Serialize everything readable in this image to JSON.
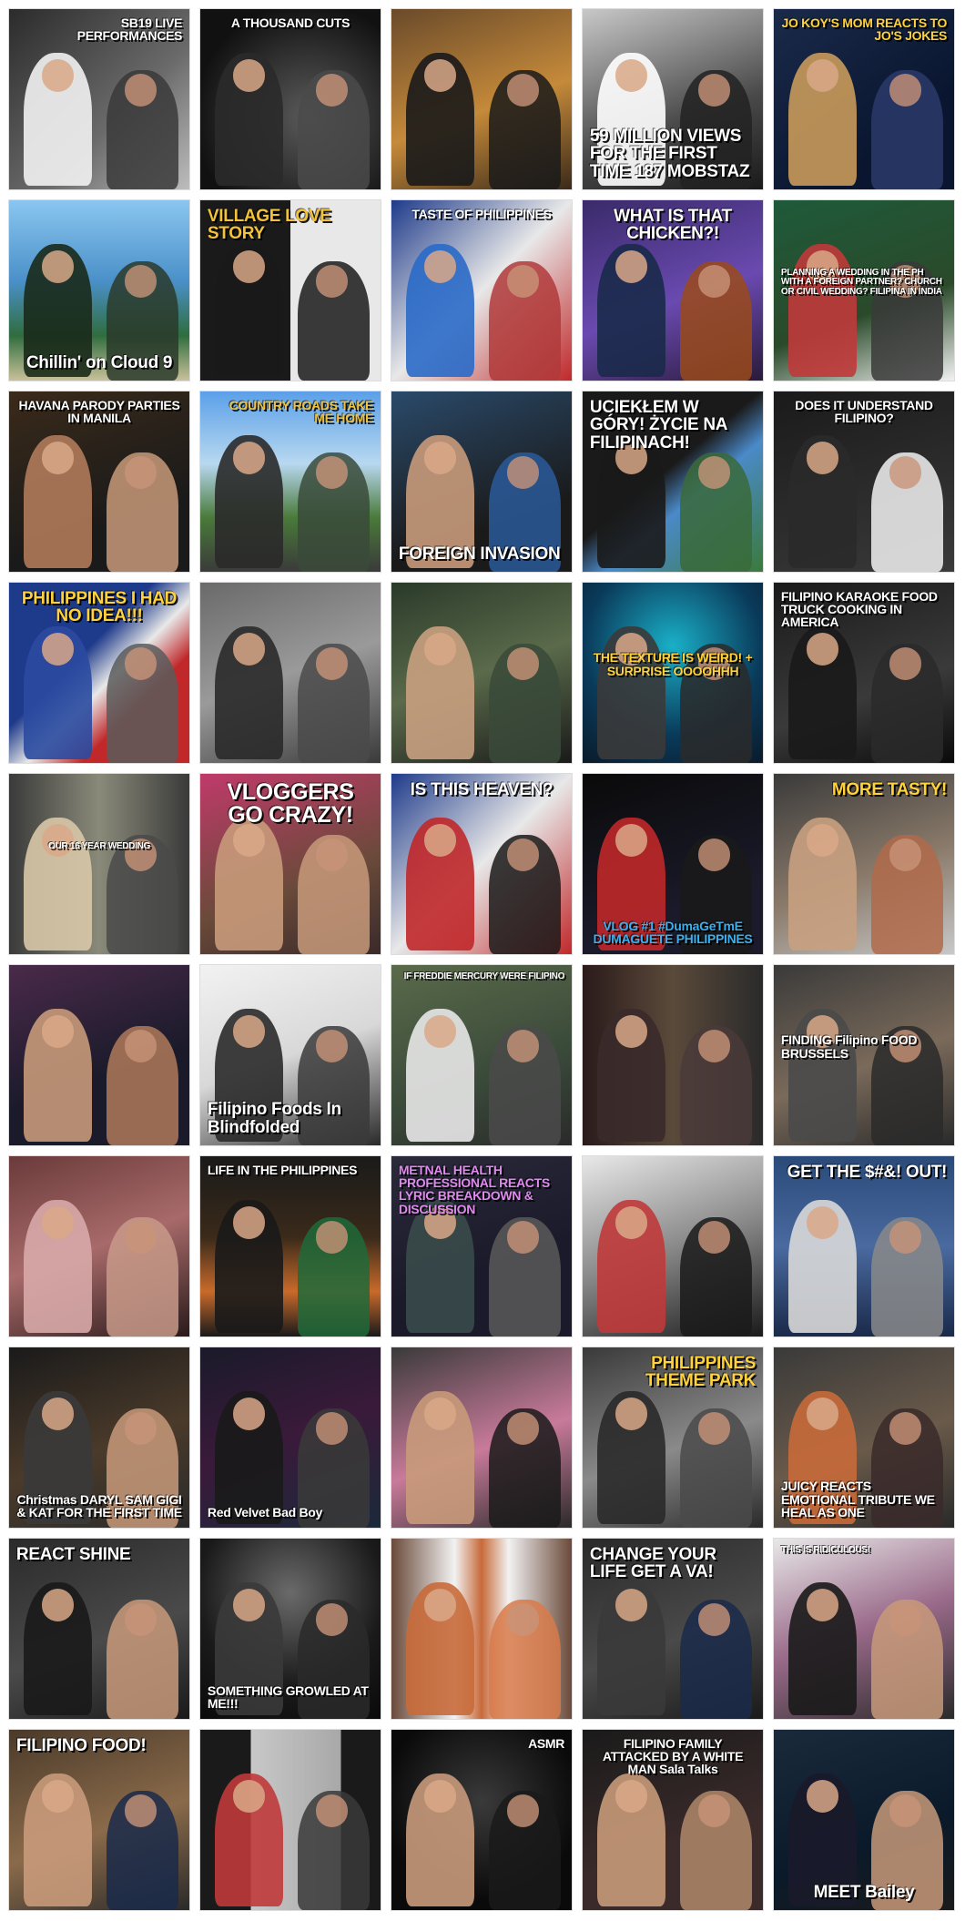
{
  "tiles": [
    {
      "caption": "SB19 LIVE PERFORMANCES",
      "bg": "linear-gradient(135deg,#2b2b2b,#6a6a6a 60%,#bdbdbd)",
      "fg": "#ffffff",
      "pos": "top",
      "align": "right",
      "size": "s",
      "fig": [
        "#f2f2f2",
        "#3a3a3a"
      ]
    },
    {
      "caption": "A THOUSAND CUTS",
      "bg": "radial-gradient(circle at 60% 60%,#5a5a5a,#111111 75%)",
      "fg": "#ffffff",
      "pos": "top",
      "align": "center",
      "size": "s",
      "fig": [
        "#2a2a2a",
        "#4a4a4a"
      ]
    },
    {
      "caption": "",
      "bg": "linear-gradient(160deg,#6a4a2a,#c58a3a 55%,#3a2a1a)",
      "fg": "#ffffff",
      "pos": "bot",
      "align": "center",
      "size": "s",
      "fig": [
        "#1a1a1a",
        "#1a1a1a"
      ]
    },
    {
      "caption": "59 MILLION VIEWS FOR THE FIRST TIME 187 MOBSTAZ",
      "bg": "linear-gradient(160deg,#c8c8c8,#4a4a4a 60%,#1a1a1a)",
      "fg": "#ffffff",
      "pos": "bot",
      "align": "left",
      "size": "m",
      "fig": [
        "#ffffff",
        "#222222"
      ]
    },
    {
      "caption": "JO KOY'S MOM REACTS TO JO'S JOKES",
      "bg": "linear-gradient(140deg,#1a2a4a,#0a1630 70%)",
      "fg": "#ffd23a",
      "pos": "top",
      "align": "right",
      "size": "s",
      "fig": [
        "#c99a5a",
        "#2a3a6a"
      ]
    },
    {
      "caption": "Chillin' on Cloud 9",
      "bg": "linear-gradient(180deg,#8ac6f0,#4a90c8 45%,#2f6d3e 75%,#c9c19a)",
      "fg": "#ffffff",
      "pos": "bot",
      "align": "center",
      "size": "m",
      "fig": [
        "#1a2a1a",
        "#2a3a2a"
      ]
    },
    {
      "caption": "VILLAGE LOVE STORY",
      "bg": "linear-gradient(90deg,#1a1a1a 50%,#e8e8e8 50%)",
      "fg": "#f2c23a",
      "pos": "top",
      "align": "left",
      "size": "m",
      "fig": [
        "#1a1a1a",
        "#1a1a1a"
      ]
    },
    {
      "caption": "TASTE OF PHILIPPINES",
      "bg": "linear-gradient(135deg,#1e3a8a,#e8e8e8 50%,#c0282a)",
      "fg": "#ffffff",
      "pos": "top",
      "align": "center",
      "size": "s",
      "fig": [
        "#2a6ac8",
        "#b03a3a"
      ]
    },
    {
      "caption": "WHAT IS THAT CHICKEN?!",
      "bg": "linear-gradient(160deg,#3a2a6a,#6a4ab0 55%,#2a1a3a)",
      "fg": "#ffffff",
      "pos": "top",
      "align": "center",
      "size": "m",
      "fig": [
        "#1a2a4a",
        "#9a4a1a"
      ]
    },
    {
      "caption": "PLANNING A WEDDING IN THE PH WITH A FOREIGN PARTNER? CHURCH OR CIVIL WEDDING? FILIPINA IN INDIA",
      "bg": "linear-gradient(160deg,#1e5a3a,#2a4a2a 60%,#f2f2f2)",
      "fg": "#ffffff",
      "pos": "mid",
      "align": "left",
      "size": "xs",
      "fig": [
        "#c03a3a",
        "#3a3a3a"
      ]
    },
    {
      "caption": "HAVANA PARODY PARTIES IN MANILA",
      "bg": "linear-gradient(160deg,#3a2a1a,#1a1a1a 70%)",
      "fg": "#ffffff",
      "pos": "top",
      "align": "center",
      "size": "s",
      "fig": [
        "#b07a5a",
        "#c89a7a"
      ]
    },
    {
      "caption": "COUNTRY ROADS TAKE ME HOME",
      "bg": "linear-gradient(180deg,#5aa0e8,#b8d8f0 40%,#4a7a3a 70%,#3a3a3a)",
      "fg": "#f2c23a",
      "pos": "top",
      "align": "right",
      "size": "s",
      "fig": [
        "#2a2a2a",
        "#3a4a3a"
      ]
    },
    {
      "caption": "FOREIGN INVASION",
      "bg": "linear-gradient(160deg,#2a4a6a,#1a1a1a 70%)",
      "fg": "#ffffff",
      "pos": "bot",
      "align": "left",
      "size": "m",
      "fig": [
        "#c89a7a",
        "#2a5a9a"
      ]
    },
    {
      "caption": "UCIEKŁEM W GÓRY! ŻYCIE NA FILIPINACH!",
      "bg": "linear-gradient(140deg,#1a1a1a 45%,#4a8ac8 60%,#3a7a3a)",
      "fg": "#ffffff",
      "pos": "top",
      "align": "left",
      "size": "m",
      "fig": [
        "#1a1a1a",
        "#3a6a3a"
      ]
    },
    {
      "caption": "DOES IT UNDERSTAND FILIPINO?",
      "bg": "linear-gradient(160deg,#1a1a1a,#3a3a3a)",
      "fg": "#ffffff",
      "pos": "top",
      "align": "center",
      "size": "s",
      "fig": [
        "#2a2a2a",
        "#f2f2f2"
      ]
    },
    {
      "caption": "PHILIPPINES I HAD NO IDEA!!!",
      "bg": "linear-gradient(135deg,#1e3a8a 40%,#e8e8e8 55%,#c0282a 70%)",
      "fg": "#ffd23a",
      "pos": "top",
      "align": "center",
      "size": "m",
      "fig": [
        "#2a4aa0",
        "#5a5a5a"
      ]
    },
    {
      "caption": "",
      "bg": "linear-gradient(160deg,#6a6a6a,#9a9a9a 50%,#3a3a3a)",
      "fg": "#ffffff",
      "pos": "bot",
      "align": "center",
      "size": "s",
      "fig": [
        "#2a2a2a",
        "#4a4a4a"
      ]
    },
    {
      "caption": "",
      "bg": "linear-gradient(160deg,#2a3a2a,#5a6a4a 50%,#1a1a1a)",
      "fg": "#ffffff",
      "pos": "bot",
      "align": "center",
      "size": "s",
      "fig": [
        "#c8a080",
        "#3a4a3a"
      ]
    },
    {
      "caption": "THE TEXTURE IS WEIRD! + SURPRISE OOOOHHH",
      "bg": "radial-gradient(circle at 50% 35%,#1ab0c8,#0a3a5a 60%,#0a1a2a)",
      "fg": "#ffd23a",
      "pos": "mid",
      "align": "center",
      "size": "s",
      "fig": [
        "#3a3a3a",
        "#2a2a2a"
      ]
    },
    {
      "caption": "FILIPINO KARAOKE FOOD TRUCK COOKING IN AMERICA",
      "bg": "linear-gradient(160deg,#1a1a1a,#3a3a3a 60%,#0a0a0a)",
      "fg": "#ffffff",
      "pos": "top",
      "align": "left",
      "size": "s",
      "fig": [
        "#1a1a1a",
        "#2a2a2a"
      ]
    },
    {
      "caption": "OUR 16 YEAR WEDDING",
      "bg": "linear-gradient(90deg,#3a3a3a,#8a8a7a 50%,#3a3a3a)",
      "fg": "#ffffff",
      "pos": "mid",
      "align": "center",
      "size": "xs",
      "fig": [
        "#d8c8a8",
        "#4a4a4a"
      ]
    },
    {
      "caption": "VLOGGERS GO CRAZY!",
      "bg": "linear-gradient(160deg,#c03a6a,#6a4a3a 60%,#3a2a2a)",
      "fg": "#ffffff",
      "pos": "top",
      "align": "center",
      "size": "l",
      "fig": [
        "#c89a7a",
        "#c89a7a"
      ]
    },
    {
      "caption": "IS THIS HEAVEN?",
      "bg": "linear-gradient(135deg,#1e3a8a,#e8e8e8 50%,#c0282a)",
      "fg": "#ffffff",
      "pos": "top",
      "align": "center",
      "size": "m",
      "fig": [
        "#c0282a",
        "#1a1a1a"
      ]
    },
    {
      "caption": "VLOG #1 #DumaGeTmE DUMAGUETE PHILIPPINES",
      "bg": "linear-gradient(160deg,#0a0a0a,#1a1a2a 70%)",
      "fg": "#3ab0f0",
      "pos": "bot",
      "align": "center",
      "size": "s",
      "fig": [
        "#c0282a",
        "#1a1a1a"
      ]
    },
    {
      "caption": "MORE TASTY!",
      "bg": "linear-gradient(160deg,#3a3a3a,#8a7a6a 55%,#c8c8c8)",
      "fg": "#ffd23a",
      "pos": "top",
      "align": "right",
      "size": "m",
      "fig": [
        "#c8a080",
        "#b06a4a"
      ]
    },
    {
      "caption": "",
      "bg": "linear-gradient(160deg,#4a2a4a,#1a1a2a 60%)",
      "fg": "#ffffff",
      "pos": "bot",
      "align": "center",
      "size": "s",
      "fig": [
        "#c89a7a",
        "#b07a5a"
      ]
    },
    {
      "caption": "Filipino Foods In Blindfolded",
      "bg": "linear-gradient(160deg,#f2f2f2,#d8d8d8 50%,#2a2a2a)",
      "fg": "#ffffff",
      "pos": "bot",
      "align": "left",
      "size": "m",
      "fig": [
        "#2a2a2a",
        "#3a3a3a"
      ]
    },
    {
      "caption": "IF FREDDIE MERCURY WERE FILIPINO",
      "bg": "linear-gradient(160deg,#5a6a4a,#3a4a3a 60%,#2a2a2a)",
      "fg": "#ffffff",
      "pos": "top",
      "align": "right",
      "size": "xs",
      "fig": [
        "#e8e8e8",
        "#4a4a4a"
      ]
    },
    {
      "caption": "",
      "bg": "linear-gradient(90deg,#2a1a1a,#5a4a3a 50%,#2a2a2a)",
      "fg": "#ffffff",
      "pos": "bot",
      "align": "center",
      "size": "s",
      "fig": [
        "#3a2a2a",
        "#4a3a3a"
      ]
    },
    {
      "caption": "FINDING Filipino FOOD BRUSSELS",
      "bg": "linear-gradient(160deg,#3a3a3a,#7a6a5a 55%,#2a2a2a)",
      "fg": "#ffffff",
      "pos": "mid",
      "align": "left",
      "size": "s",
      "fig": [
        "#4a4a4a",
        "#2a2a2a"
      ]
    },
    {
      "caption": "",
      "bg": "linear-gradient(160deg,#6a3a3a,#a86a6a 50%,#2a1a1a)",
      "fg": "#ffffff",
      "pos": "bot",
      "align": "center",
      "size": "s",
      "fig": [
        "#d8a8a8",
        "#c89a8a"
      ]
    },
    {
      "caption": "LIFE IN THE PHILIPPINES",
      "bg": "linear-gradient(180deg,#1a1a1a,#3a2a1a 45%,#c86a2a 75%,#1a1a1a)",
      "fg": "#ffffff",
      "pos": "top",
      "align": "left",
      "size": "s",
      "fig": [
        "#1a1a1a",
        "#1e6a3a"
      ]
    },
    {
      "caption": "METNAL HEALTH PROFESSIONAL REACTS LYRIC BREAKDOWN & DISCUSSION",
      "bg": "linear-gradient(160deg,#2a2a3a,#1a1a2a 60%)",
      "fg": "#e08af0",
      "pos": "top",
      "align": "left",
      "size": "s",
      "fig": [
        "#3a4a4a",
        "#5a5a5a"
      ]
    },
    {
      "caption": "",
      "bg": "linear-gradient(160deg,#e8e8e8,#8a8a8a 50%,#1a1a1a)",
      "fg": "#ffffff",
      "pos": "bot",
      "align": "center",
      "size": "s",
      "fig": [
        "#c03a3a",
        "#1a1a1a"
      ]
    },
    {
      "caption": "GET THE $#&! OUT!",
      "bg": "linear-gradient(180deg,#2a4a7a,#4a6aa0 50%,#1a2a4a)",
      "fg": "#ffffff",
      "pos": "top",
      "align": "right",
      "size": "m",
      "fig": [
        "#d8d8d8",
        "#8a8a8a"
      ]
    },
    {
      "caption": "Christmas DARYL SAM GIGI & KAT FOR THE FIRST TIME",
      "bg": "linear-gradient(160deg,#1a1a1a,#4a3a2a 55%,#2a2a2a)",
      "fg": "#ffffff",
      "pos": "bot",
      "align": "center",
      "size": "s",
      "fig": [
        "#3a3a3a",
        "#c89a7a"
      ]
    },
    {
      "caption": "Red Velvet Bad Boy",
      "bg": "linear-gradient(160deg,#1a1a2a,#3a1a3a 50%,#1a2a3a)",
      "fg": "#ffffff",
      "pos": "bot",
      "align": "left",
      "size": "s",
      "fig": [
        "#1a1a1a",
        "#3a3a3a"
      ]
    },
    {
      "caption": "",
      "bg": "linear-gradient(160deg,#3a3a3a,#c87a9a 55%,#2a2a2a)",
      "fg": "#ffffff",
      "pos": "bot",
      "align": "center",
      "size": "s",
      "fig": [
        "#c89a7a",
        "#1a1a1a"
      ]
    },
    {
      "caption": "PHILIPPINES THEME PARK",
      "bg": "linear-gradient(160deg,#3a3a3a,#8a8a8a 55%,#2a2a2a)",
      "fg": "#ffd23a",
      "pos": "top",
      "align": "right",
      "size": "m",
      "fig": [
        "#2a2a2a",
        "#4a4a4a"
      ]
    },
    {
      "caption": "JUICY REACTS EMOTIONAL TRIBUTE WE HEAL AS ONE",
      "bg": "linear-gradient(160deg,#3a3a3a,#6a5a4a 55%,#2a2a2a)",
      "fg": "#ffffff",
      "pos": "bot",
      "align": "left",
      "size": "s",
      "fig": [
        "#c86a3a",
        "#3a2a2a"
      ]
    },
    {
      "caption": "REACT SHINE",
      "bg": "linear-gradient(160deg,#2a2a2a,#4a4a4a 55%,#1a1a1a)",
      "fg": "#ffffff",
      "pos": "top",
      "align": "left",
      "size": "m",
      "fig": [
        "#1a1a1a",
        "#c89a7a"
      ]
    },
    {
      "caption": "SOMETHING GROWLED AT ME!!!",
      "bg": "radial-gradient(circle at 50% 30%,#6a6a6a,#1a1a1a 60%,#0a0a0a)",
      "fg": "#ffffff",
      "pos": "bot",
      "align": "left",
      "size": "s",
      "fig": [
        "#3a3a3a",
        "#2a2a2a"
      ]
    },
    {
      "caption": "",
      "bg": "linear-gradient(90deg,#6a4a3a,#f2f2f2 35%,#c86a3a 50%,#f2f2f2 65%,#6a4a3a)",
      "fg": "#ffffff",
      "pos": "bot",
      "align": "center",
      "size": "s",
      "fig": [
        "#c86a3a",
        "#d87a4a"
      ]
    },
    {
      "caption": "CHANGE YOUR LIFE GET A VA!",
      "bg": "linear-gradient(160deg,#2a2a2a,#4a4a4a 55%,#1a1a1a)",
      "fg": "#ffffff",
      "pos": "top",
      "align": "left",
      "size": "m",
      "fig": [
        "#3a3a3a",
        "#1a2a4a"
      ]
    },
    {
      "caption": "THIS IS RIDICULOUS!",
      "bg": "linear-gradient(160deg,#e8e8e8,#9a6a8a 50%,#2a2a2a)",
      "fg": "#ffffff",
      "pos": "top",
      "align": "left",
      "size": "xs",
      "fig": [
        "#1a1a1a",
        "#c89a7a"
      ]
    },
    {
      "caption": "FILIPINO FOOD!",
      "bg": "linear-gradient(160deg,#4a3a2a,#8a6a4a 55%,#2a2a2a)",
      "fg": "#ffffff",
      "pos": "top",
      "align": "left",
      "size": "m",
      "fig": [
        "#c89a7a",
        "#1a2a4a"
      ]
    },
    {
      "caption": "",
      "bg": "linear-gradient(90deg,#1a1a1a 28%,#c8c8c8 28%,#a8a8a8 78%,#1a1a1a 78%)",
      "fg": "#ffffff",
      "pos": "bot",
      "align": "center",
      "size": "s",
      "fig": [
        "#c03a3a",
        "#3a3a3a"
      ]
    },
    {
      "caption": "ASMR",
      "bg": "radial-gradient(circle at 50% 40%,#3a3a3a,#0a0a0a 70%)",
      "fg": "#ffffff",
      "pos": "top",
      "align": "right",
      "size": "s",
      "fig": [
        "#c89a7a",
        "#1a1a1a"
      ]
    },
    {
      "caption": "FILIPINO FAMILY ATTACKED BY A WHITE MAN Sala Talks",
      "bg": "linear-gradient(160deg,#1a1a1a,#3a2a2a 60%)",
      "fg": "#ffffff",
      "pos": "top",
      "align": "center",
      "size": "s",
      "fig": [
        "#c89a7a",
        "#b08a6a"
      ]
    },
    {
      "caption": "MEET Bailey",
      "bg": "linear-gradient(160deg,#1a2a3a,#0a1a2a 60%,#1a1a1a)",
      "fg": "#ffffff",
      "pos": "bot",
      "align": "center",
      "size": "m",
      "fig": [
        "#1a1a2a",
        "#c89a7a"
      ]
    }
  ]
}
